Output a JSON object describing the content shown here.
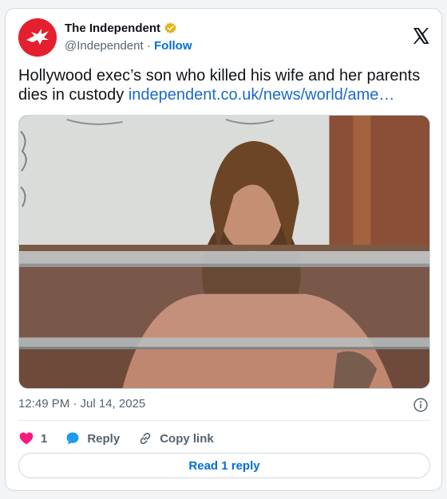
{
  "author": {
    "display_name": "The Independent",
    "handle": "@Independent",
    "follow_label": "Follow",
    "separator": "·"
  },
  "tweet": {
    "text": "Hollywood exec’s son who killed his wife and her parents dies in custody",
    "link_text": "independent.co.uk/news/world/ame…"
  },
  "meta": {
    "timestamp": "12:49 PM · Jul 14, 2025"
  },
  "actions": {
    "like_count": "1",
    "reply_label": "Reply",
    "copy_link_label": "Copy link"
  },
  "footer": {
    "read_replies_label": "Read 1 reply"
  },
  "colors": {
    "brand_red": "#e5202e",
    "link_blue": "#1b6bc8",
    "like_pink": "#f91880",
    "reply_blue": "#1d9bf0",
    "verified_gold": "#e2b719"
  },
  "icons": {
    "avatar": "independent-eagle-logo",
    "verified": "verified-badge-icon",
    "platform": "x-logo-icon",
    "info": "info-icon",
    "like": "heart-icon",
    "reply": "reply-bubble-icon",
    "copy": "link-icon"
  }
}
